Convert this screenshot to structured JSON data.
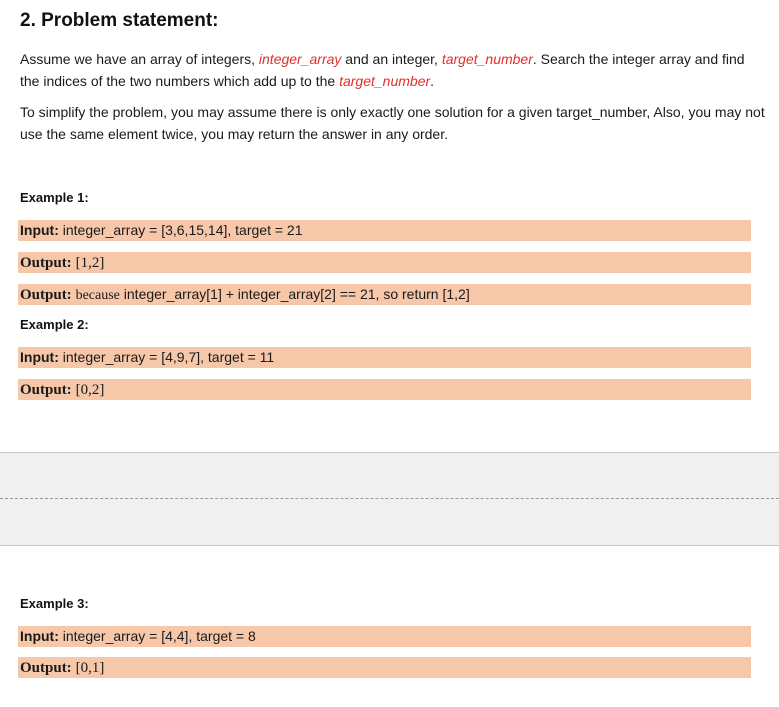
{
  "section": {
    "heading": "2. Problem statement:"
  },
  "paragraph1": {
    "t1": "Assume we have an array of integers, ",
    "r1": "integer_array",
    "t2": " and an integer, ",
    "r2": "target_number",
    "t3": ". Search the integer array and find the indices of the two numbers which add up to the ",
    "r3": "target_number",
    "t4": "."
  },
  "paragraph2": {
    "text": "To simplify the problem, you may assume there is only exactly one solution for a given target_number, Also, you may not use the same element twice, you may return the answer in any order."
  },
  "example1": {
    "title": "Example 1:",
    "input_label": "Input:",
    "input_value": "integer_array = [3,6,15,14], target = 21",
    "output_label": "Output:",
    "output_value": "[1,2]",
    "explain_label": "Output:",
    "explain_word": "because",
    "explain_value": "integer_array[1] + integer_array[2] == 21, so return [1,2]"
  },
  "example2": {
    "title": "Example 2:",
    "input_label": "Input:",
    "input_value": "integer_array = [4,9,7], target = 11",
    "output_label": "Output:",
    "output_value": "[0,2]"
  },
  "example3": {
    "title": "Example 3:",
    "input_label": "Input:",
    "input_value": "integer_array = [4,4], target = 8",
    "output_label": "Output:",
    "output_value": "[0,1]"
  },
  "colors": {
    "highlight": "#f6c7a8",
    "red_text": "#e0302a",
    "page_break_band": "#f0f0f0"
  }
}
